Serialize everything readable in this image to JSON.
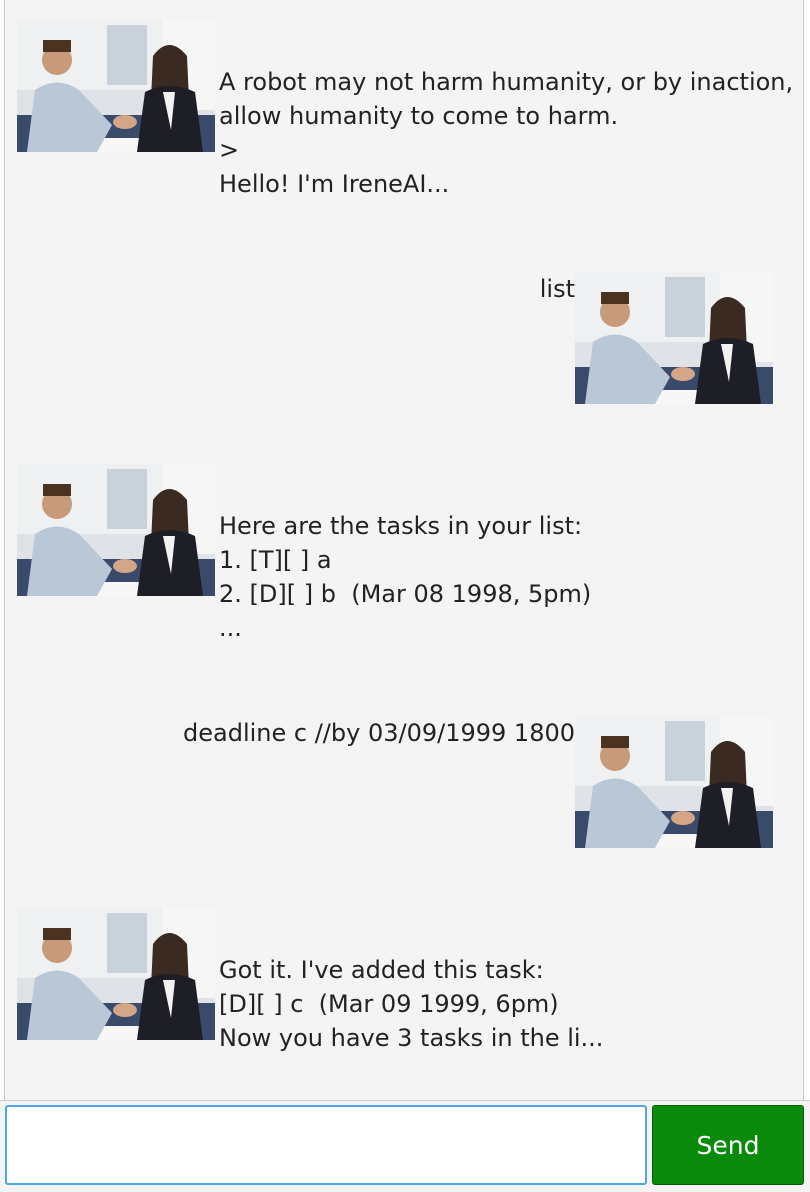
{
  "messages": [
    {
      "sender": "bot",
      "text": "A robot may not harm humanity, or by inaction,\nallow humanity to come to harm.\n>\nHello! I'm IreneAI..."
    },
    {
      "sender": "user",
      "text": "list"
    },
    {
      "sender": "bot",
      "text": "Here are the tasks in your list:\n1. [T][ ] a\n2. [D][ ] b  (Mar 08 1998, 5pm)\n..."
    },
    {
      "sender": "user",
      "text": "deadline c //by 03/09/1999 1800"
    },
    {
      "sender": "bot",
      "text": "Got it. I've added this task:\n[D][ ] c  (Mar 09 1999, 6pm)\nNow you have 3 tasks in the li..."
    }
  ],
  "input": {
    "value": "",
    "placeholder": ""
  },
  "send_label": "Send",
  "colors": {
    "send_bg": "#0a8a0a",
    "input_border": "#4da6e8",
    "window_bg": "#f4f4f4"
  }
}
